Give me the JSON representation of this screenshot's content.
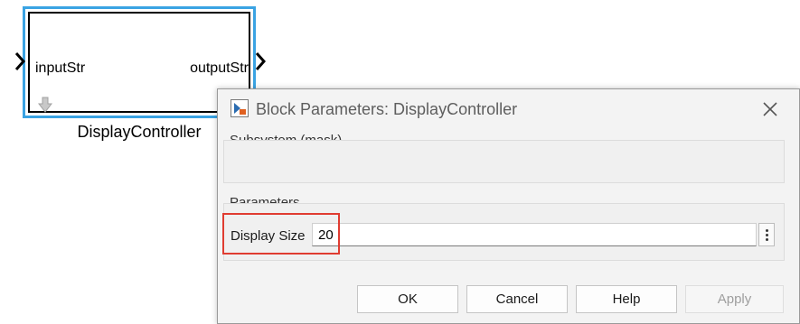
{
  "block": {
    "name": "DisplayController",
    "input_port": "inputStr",
    "output_port": "outputStr"
  },
  "dialog": {
    "title": "Block Parameters: DisplayController",
    "mask_section": "Subsystem (mask)",
    "params_section": "Parameters",
    "parameter": {
      "label": "Display Size",
      "value": "20"
    },
    "buttons": {
      "ok": "OK",
      "cancel": "Cancel",
      "help": "Help",
      "apply": "Apply"
    }
  },
  "colors": {
    "block_selection": "#3aa3e3",
    "highlight": "#e03c31"
  },
  "icons": [
    "arrow-right-icon",
    "arrow-down-icon",
    "simulink-block-icon",
    "close-icon",
    "kebab-menu-icon"
  ]
}
